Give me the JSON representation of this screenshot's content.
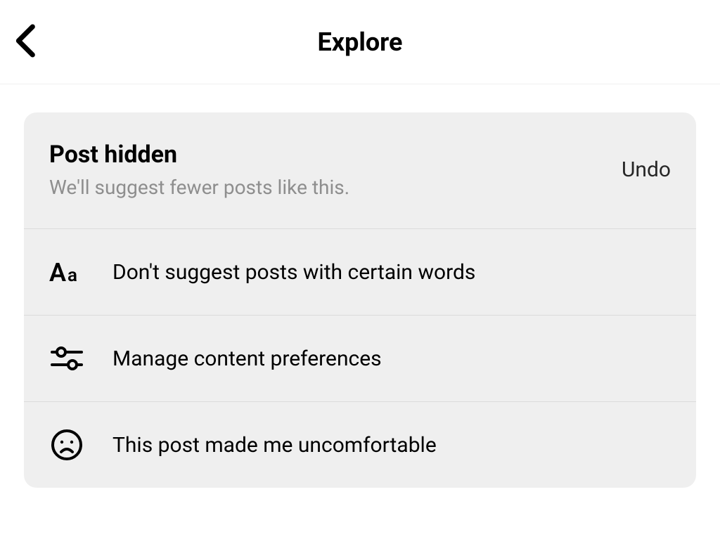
{
  "header": {
    "title": "Explore"
  },
  "card": {
    "title": "Post hidden",
    "subtitle": "We'll suggest fewer posts like this.",
    "undo_label": "Undo",
    "options": [
      {
        "icon": "text-aa-icon",
        "label": "Don't suggest posts with certain words"
      },
      {
        "icon": "sliders-icon",
        "label": "Manage content preferences"
      },
      {
        "icon": "sad-face-icon",
        "label": "This post made me uncomfortable"
      }
    ]
  }
}
